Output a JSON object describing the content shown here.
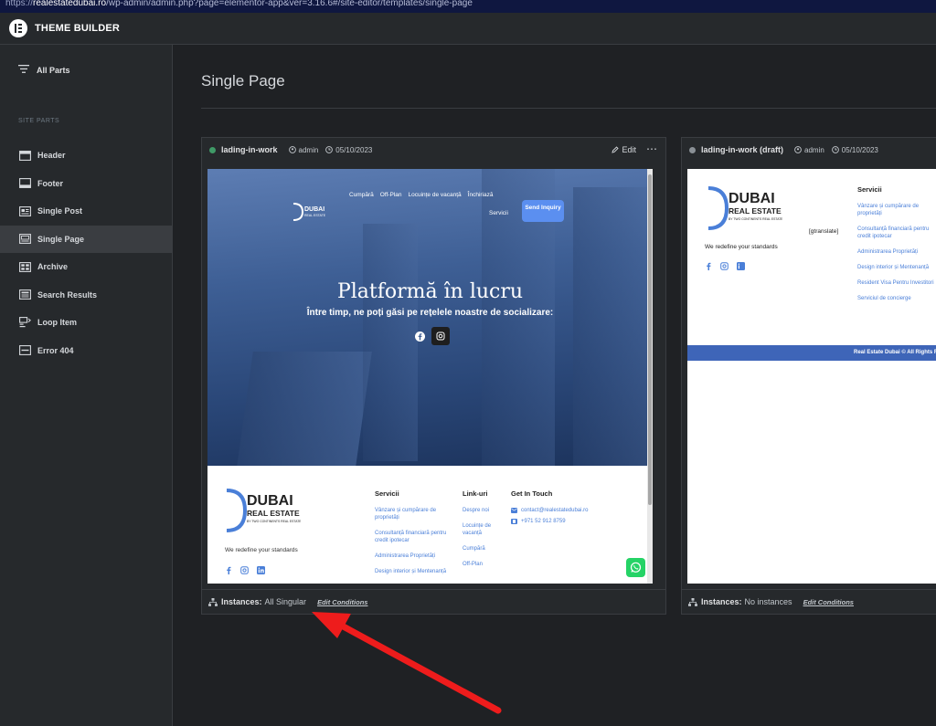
{
  "browser": {
    "url_proto": "https://",
    "url_host": "realestatedubai.ro",
    "url_path": "/wp-admin/admin.php?page=elementor-app&ver=3.16.6#/site-editor/templates/single-page"
  },
  "app": {
    "title": "THEME BUILDER"
  },
  "sidebar": {
    "all_parts": "All Parts",
    "section_label": "SITE PARTS",
    "items": [
      {
        "label": "Header",
        "icon": "header-icon"
      },
      {
        "label": "Footer",
        "icon": "footer-icon"
      },
      {
        "label": "Single Post",
        "icon": "single-post-icon"
      },
      {
        "label": "Single Page",
        "icon": "single-page-icon",
        "active": true
      },
      {
        "label": "Archive",
        "icon": "archive-icon"
      },
      {
        "label": "Search Results",
        "icon": "search-results-icon"
      },
      {
        "label": "Loop Item",
        "icon": "loop-item-icon"
      },
      {
        "label": "Error 404",
        "icon": "error-404-icon"
      }
    ]
  },
  "main": {
    "title": "Single Page",
    "cards": [
      {
        "name": "lading-in-work",
        "status_color": "#3f9a67",
        "author": "admin",
        "date": "05/10/2023",
        "edit_label": "Edit",
        "instances_label": "Instances:",
        "instances_value": "All Singular",
        "edit_conditions": "Edit Conditions",
        "preview": {
          "nav": [
            "Cumpără",
            "Off-Plan",
            "Locuințe de vacanță",
            "Închiriază"
          ],
          "nav2": "Servicii",
          "send_btn": "Send Inquiry",
          "hero_title": "Platformă în lucru",
          "hero_sub": "Între timp, ne poți găsi pe rețelele noastre de socializare:",
          "logo_text": "DUBAI",
          "logo_sub": "REAL ESTATE",
          "logo_mini": "BY TWO CONTINENTS REAL ESTATE",
          "tagline": "We redefine your standards",
          "servicii_h": "Servicii",
          "servicii": [
            "Vânzare și cumpărare de proprietăți",
            "Consultanță financiară pentru credit ipotecar",
            "Administrarea Proprietăți",
            "Design interior și Mentenanță"
          ],
          "linkuri_h": "Link-uri",
          "linkuri": [
            "Despre noi",
            "Locuințe de vacanță",
            "Cumpără",
            "Off-Plan"
          ],
          "contact_h": "Get In Touch",
          "email": "contact@realestatedubai.ro",
          "phone": "+971 52 912 8759"
        }
      },
      {
        "name": "lading-in-work (draft)",
        "status_color": "#8a9096",
        "author": "admin",
        "date": "05/10/2023",
        "instances_label": "Instances:",
        "instances_value": "No instances",
        "edit_conditions": "Edit Conditions",
        "preview": {
          "logo_text": "DUBAI",
          "logo_sub": "REAL ESTATE",
          "logo_mini": "BY TWO CONTINENTS REAL ESTATE",
          "tagline": "We redefine your standards",
          "gtranslate": "[gtranslate]",
          "servicii_h": "Servicii",
          "servicii": [
            "Vânzare și cumpărare de proprietăți",
            "Consultanță financiară pentru credit ipotecar",
            "Administrarea Proprietăți",
            "Design interior și Mentenanță",
            "Resident Visa Pentru Investitori",
            "Serviciul de concierge"
          ],
          "footer_text": "Real Estate Dubai © All Rights Reserved"
        }
      }
    ]
  }
}
